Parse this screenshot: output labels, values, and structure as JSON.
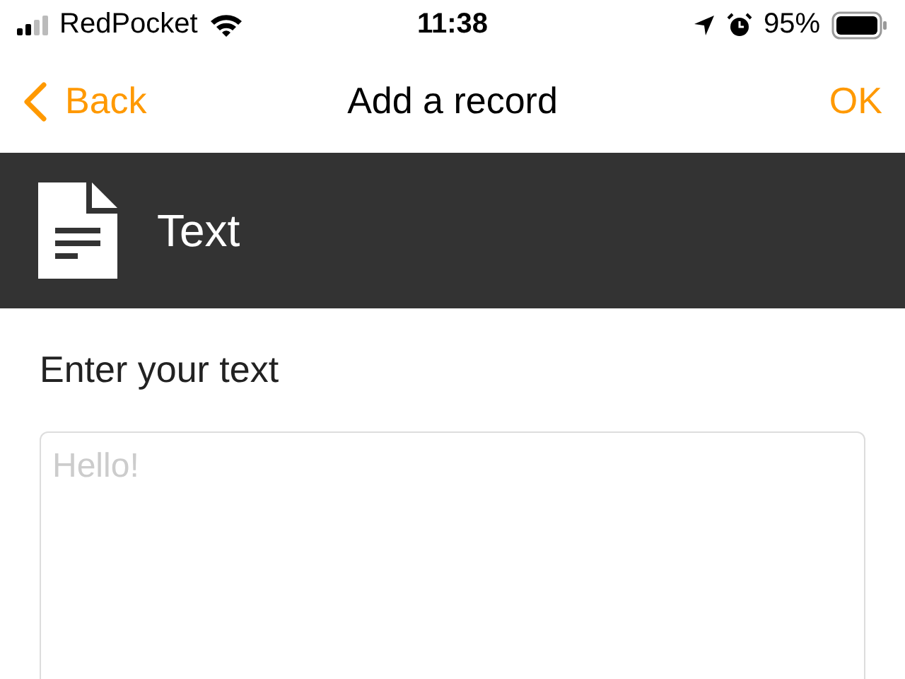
{
  "status_bar": {
    "carrier": "RedPocket",
    "time": "11:38",
    "battery": "95%"
  },
  "nav_bar": {
    "back": "Back",
    "title": "Add a record",
    "ok": "OK"
  },
  "header": {
    "title": "Text"
  },
  "form": {
    "label": "Enter your text",
    "placeholder": "Hello!"
  }
}
